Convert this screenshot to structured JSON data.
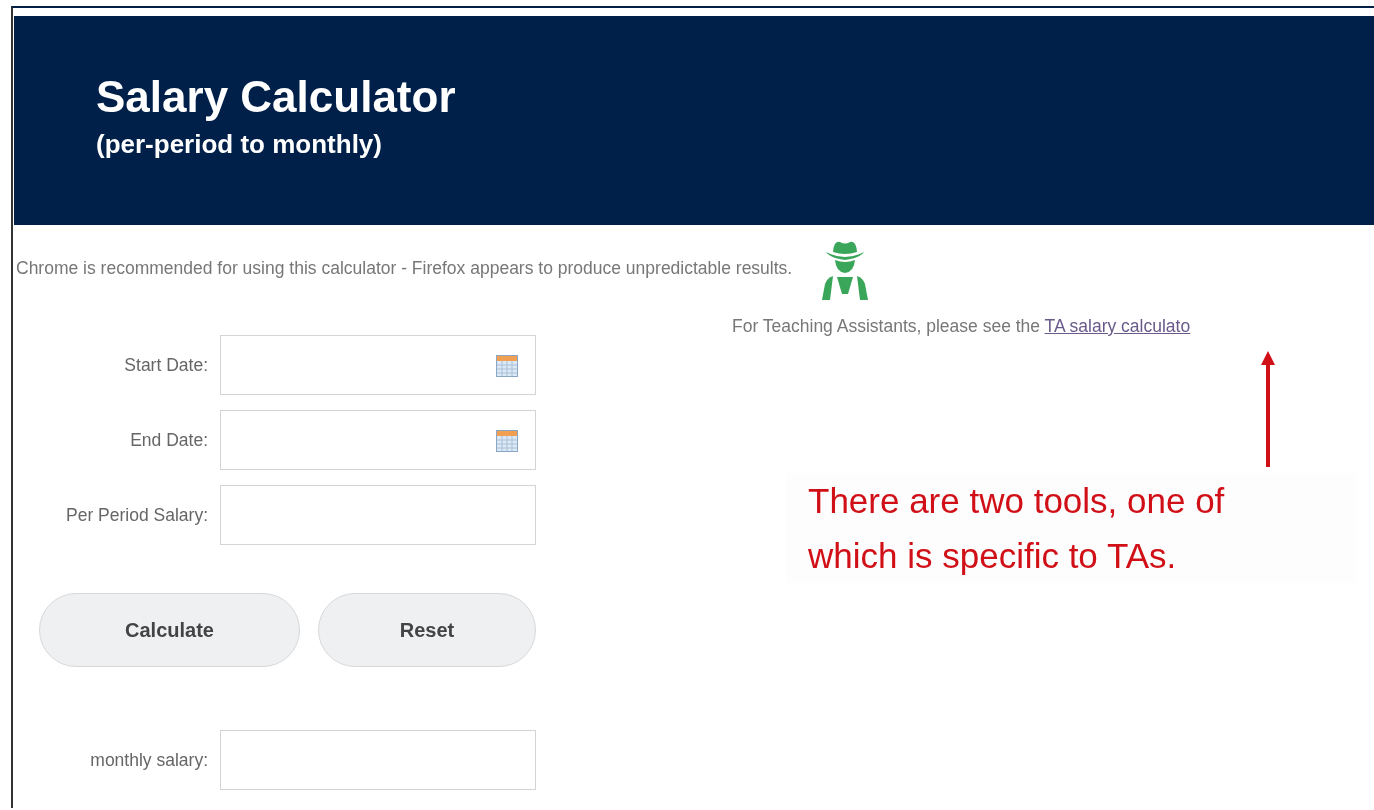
{
  "header": {
    "title": "Salary Calculator",
    "subtitle": "(per-period to monthly)"
  },
  "notice": "Chrome is recommended for using this calculator - Firefox appears to produce unpredictable results.",
  "ta_note": {
    "text": "For Teaching Assistants, please see the",
    "link": "TA salary calculato"
  },
  "fields": [
    {
      "label": "Start Date:",
      "kind": "date"
    },
    {
      "label": "End Date:",
      "kind": "date"
    },
    {
      "label": "Per Period Salary:",
      "kind": "text"
    }
  ],
  "buttons": [
    "Calculate",
    "Reset"
  ],
  "result_field": {
    "label": "monthly salary:"
  },
  "annotation": "There are two tools, one of\nwhich is specific to TAs."
}
